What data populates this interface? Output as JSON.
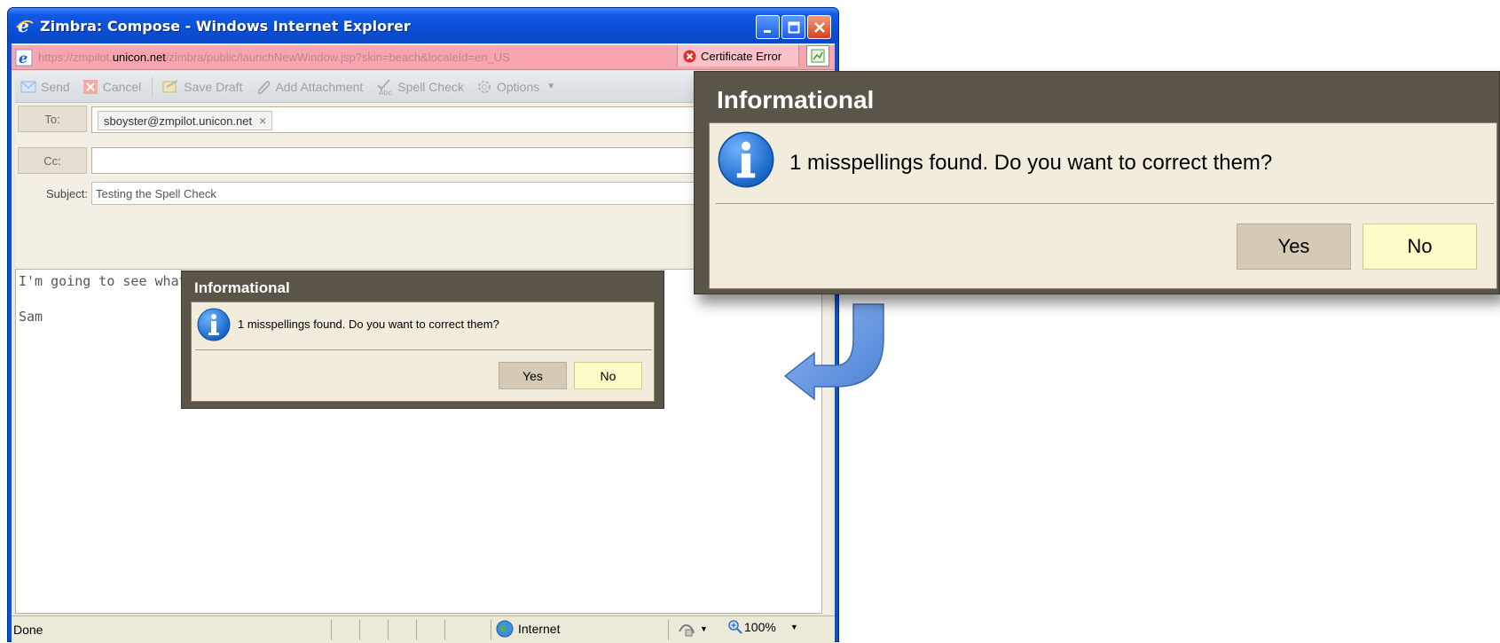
{
  "window": {
    "title": "Zimbra: Compose - Windows Internet Explorer"
  },
  "address": {
    "url_prefix": "https://zmpilot.",
    "url_host": "unicon.net",
    "url_suffix": "/zimbra/public/launchNewWindow.jsp?skin=beach&localeId=en_US",
    "cert_error": "Certificate Error"
  },
  "toolbar": {
    "send": "Send",
    "cancel": "Cancel",
    "save_draft": "Save Draft",
    "add_attachment": "Add Attachment",
    "spell_check": "Spell Check",
    "options": "Options"
  },
  "compose": {
    "to_label": "To:",
    "to_recipient": "sboyster@zmpilot.unicon.net",
    "chip_remove": "×",
    "cc_label": "Cc:",
    "cc_value": "",
    "subject_label": "Subject:",
    "subject_value": "Testing the Spell Check",
    "body_line1": "I'm going to see what the spell with caatch.",
    "body_line2": "Sam"
  },
  "dialog": {
    "title": "Informational",
    "message": "1 misspellings found. Do you want to correct them?",
    "yes": "Yes",
    "no": "No"
  },
  "status": {
    "text": "Done",
    "zone": "Internet",
    "zoom": "100%"
  },
  "colors": {
    "titlebar": "#0a4fd6",
    "address_error_bg": "#f9a5b0",
    "dialog_frame": "#5b5448",
    "dialog_body": "#f2ecdd",
    "no_button": "#fdfbc6",
    "callout_arrow": "#5b8ee0"
  }
}
